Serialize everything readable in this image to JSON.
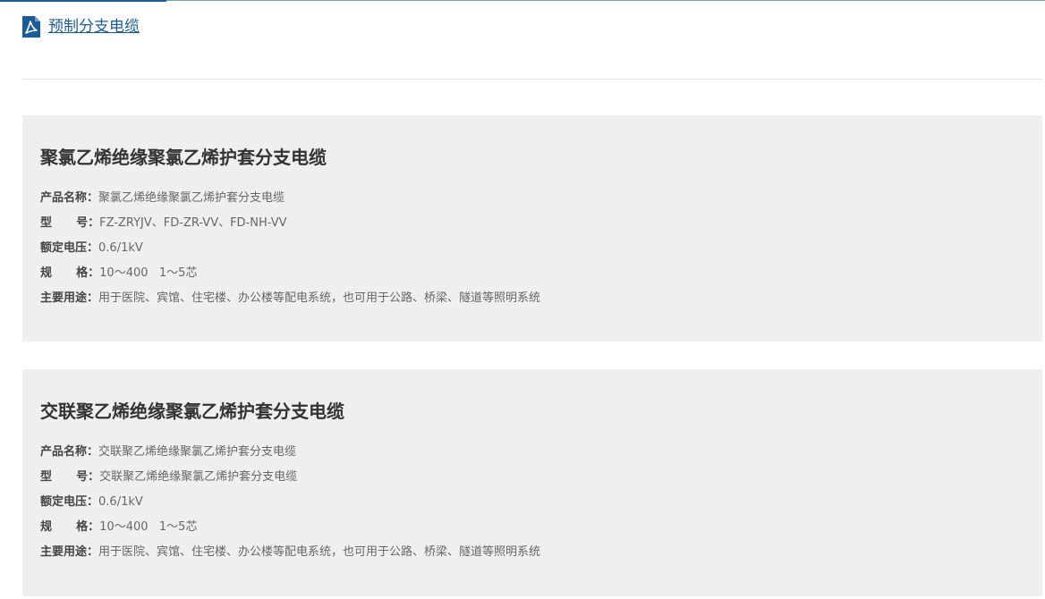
{
  "document": {
    "link_label": "预制分支电缆",
    "icon": "pdf-file-icon",
    "icon_color": "#1a5c96"
  },
  "products": [
    {
      "title": "聚氯乙烯绝缘聚氯乙烯护套分支电缆",
      "specs": [
        {
          "label": "产品名称：",
          "value": "聚氯乙烯绝缘聚氯乙烯护套分支电缆"
        },
        {
          "label": "型      号：",
          "value": "FZ-ZRYJV、FD-ZR-VV、FD-NH-VV"
        },
        {
          "label": "额定电压：",
          "value": "0.6/1kV"
        },
        {
          "label": "规      格：",
          "value": "10～400   1～5芯"
        },
        {
          "label": "主要用途：",
          "value": "用于医院、宾馆、住宅楼、办公楼等配电系统，也可用于公路、桥梁、隧道等照明系统"
        }
      ]
    },
    {
      "title": "交联聚乙烯绝缘聚氯乙烯护套分支电缆",
      "specs": [
        {
          "label": "产品名称：",
          "value": "交联聚乙烯绝缘聚氯乙烯护套分支电缆"
        },
        {
          "label": "型      号：",
          "value": "交联聚乙烯绝缘聚氯乙烯护套分支电缆"
        },
        {
          "label": "额定电压：",
          "value": "0.6/1kV"
        },
        {
          "label": "规      格：",
          "value": "10～400   1～5芯"
        },
        {
          "label": "主要用途：",
          "value": "用于医院、宾馆、住宅楼、办公楼等配电系统，也可用于公路、桥梁、隧道等照明系统"
        }
      ]
    }
  ],
  "colors": {
    "card_background": "#efefef",
    "link": "#1a5c96",
    "label": "#444444",
    "value": "#666666"
  }
}
